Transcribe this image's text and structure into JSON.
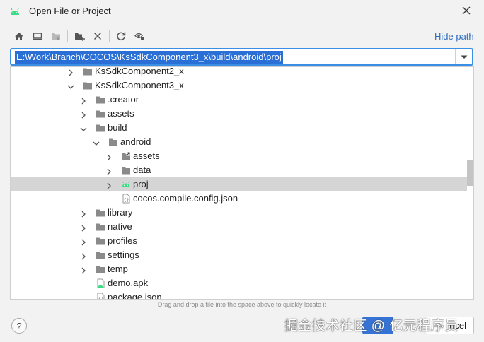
{
  "window": {
    "title": "Open File or Project",
    "icon": "android-icon",
    "close_icon": "close-icon"
  },
  "toolbar": {
    "buttons": [
      {
        "icon": "home-icon",
        "enabled": true
      },
      {
        "icon": "desktop-icon",
        "enabled": true
      },
      {
        "icon": "project-folder-icon",
        "enabled": false
      },
      {
        "icon": "new-folder-icon",
        "enabled": true
      },
      {
        "icon": "delete-icon",
        "enabled": true
      },
      {
        "icon": "refresh-icon",
        "enabled": true
      },
      {
        "icon": "show-hidden-icon",
        "enabled": true
      }
    ],
    "hide_path_label": "Hide path"
  },
  "path_field": {
    "value": "E:\\Work\\Branch\\COCOS\\KsSdkComponent3_x\\build\\android\\proj"
  },
  "tree": {
    "items": [
      {
        "label": "KsSdkComponent2_x",
        "level": 0,
        "expanded": false,
        "icon": "folder-icon",
        "selected": false
      },
      {
        "label": "KsSdkComponent3_x",
        "level": 0,
        "expanded": true,
        "icon": "folder-icon",
        "selected": false
      },
      {
        "label": ".creator",
        "level": 1,
        "expanded": false,
        "icon": "folder-icon",
        "selected": false
      },
      {
        "label": "assets",
        "level": 1,
        "expanded": false,
        "icon": "folder-icon",
        "selected": false
      },
      {
        "label": "build",
        "level": 1,
        "expanded": true,
        "icon": "folder-icon",
        "selected": false
      },
      {
        "label": "android",
        "level": 2,
        "expanded": true,
        "icon": "folder-icon",
        "selected": false
      },
      {
        "label": "assets",
        "level": 3,
        "expanded": false,
        "icon": "linked-folder-icon",
        "selected": false
      },
      {
        "label": "data",
        "level": 3,
        "expanded": false,
        "icon": "folder-icon",
        "selected": false
      },
      {
        "label": "proj",
        "level": 3,
        "expanded": false,
        "icon": "android-icon",
        "selected": true
      },
      {
        "label": "cocos.compile.config.json",
        "level": 3,
        "expanded": null,
        "icon": "json-file-icon",
        "selected": false
      },
      {
        "label": "library",
        "level": 1,
        "expanded": false,
        "icon": "folder-icon",
        "selected": false
      },
      {
        "label": "native",
        "level": 1,
        "expanded": false,
        "icon": "folder-icon",
        "selected": false
      },
      {
        "label": "profiles",
        "level": 1,
        "expanded": false,
        "icon": "folder-icon",
        "selected": false
      },
      {
        "label": "settings",
        "level": 1,
        "expanded": false,
        "icon": "folder-icon",
        "selected": false
      },
      {
        "label": "temp",
        "level": 1,
        "expanded": false,
        "icon": "folder-icon",
        "selected": false
      },
      {
        "label": "demo.apk",
        "level": 1,
        "expanded": null,
        "icon": "apk-file-icon",
        "selected": false
      },
      {
        "label": "package.json",
        "level": 1,
        "expanded": null,
        "icon": "json-file-icon",
        "selected": false
      }
    ]
  },
  "hint": "Drag and drop a file into the space above to quickly locate it",
  "footer": {
    "help_label": "?",
    "cancel_label": "ncel"
  },
  "watermark": "掘金技术社区 @ 亿元程序员",
  "colors": {
    "accent": "#3574d6",
    "selection_row": "#d5d5d5",
    "android_green": "#3ddc84",
    "folder_gray": "#8a8a8a",
    "link_blue": "#2f6fc0"
  }
}
